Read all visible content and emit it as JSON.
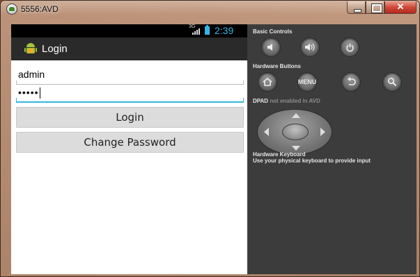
{
  "window": {
    "title": "5556:AVD",
    "close_label": "✕"
  },
  "status_bar": {
    "network": "3G",
    "time": "2:39",
    "accent": "#33b5e5"
  },
  "app": {
    "title": "Login",
    "icon": "android-app-icon"
  },
  "form": {
    "username_value": "admin",
    "password_value": "•••••",
    "login_label": "Login",
    "change_password_label": "Change Password"
  },
  "controls": {
    "basic_controls_label": "Basic Controls",
    "hardware_buttons_label": "Hardware Buttons",
    "menu_label": "MENU",
    "dpad_label": "DPAD",
    "dpad_note": "not enabled in AVD",
    "keyboard_label": "Hardware Keyboard",
    "keyboard_note": "Use your physical keyboard to provide input",
    "icons": [
      "volume-down-icon",
      "volume-up-icon",
      "power-icon",
      "home-icon",
      "menu-button",
      "back-icon",
      "search-icon"
    ]
  }
}
